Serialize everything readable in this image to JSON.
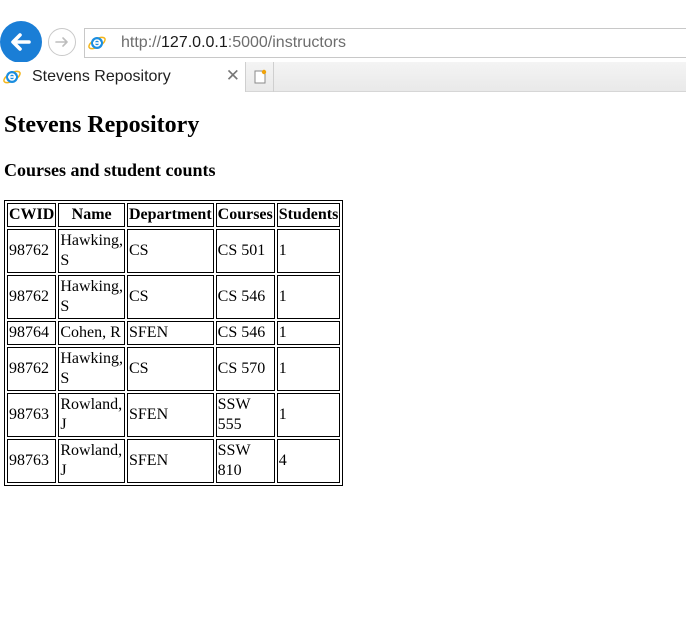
{
  "browser": {
    "url_prefix": "http://",
    "url_host": "127.0.0.1",
    "url_rest": ":5000/instructors",
    "tab_title": "Stevens Repository",
    "accent_color": "#1a7ed6"
  },
  "page": {
    "title": "Stevens Repository",
    "subtitle": "Courses and student counts"
  },
  "table": {
    "headers": [
      "CWID",
      "Name",
      "Department",
      "Courses",
      "Students"
    ],
    "rows": [
      [
        "98762",
        "Hawking, S",
        "CS",
        "CS 501",
        "1"
      ],
      [
        "98762",
        "Hawking, S",
        "CS",
        "CS 546",
        "1"
      ],
      [
        "98764",
        "Cohen, R",
        "SFEN",
        "CS 546",
        "1"
      ],
      [
        "98762",
        "Hawking, S",
        "CS",
        "CS 570",
        "1"
      ],
      [
        "98763",
        "Rowland, J",
        "SFEN",
        "SSW 555",
        "1"
      ],
      [
        "98763",
        "Rowland, J",
        "SFEN",
        "SSW 810",
        "4"
      ]
    ]
  }
}
